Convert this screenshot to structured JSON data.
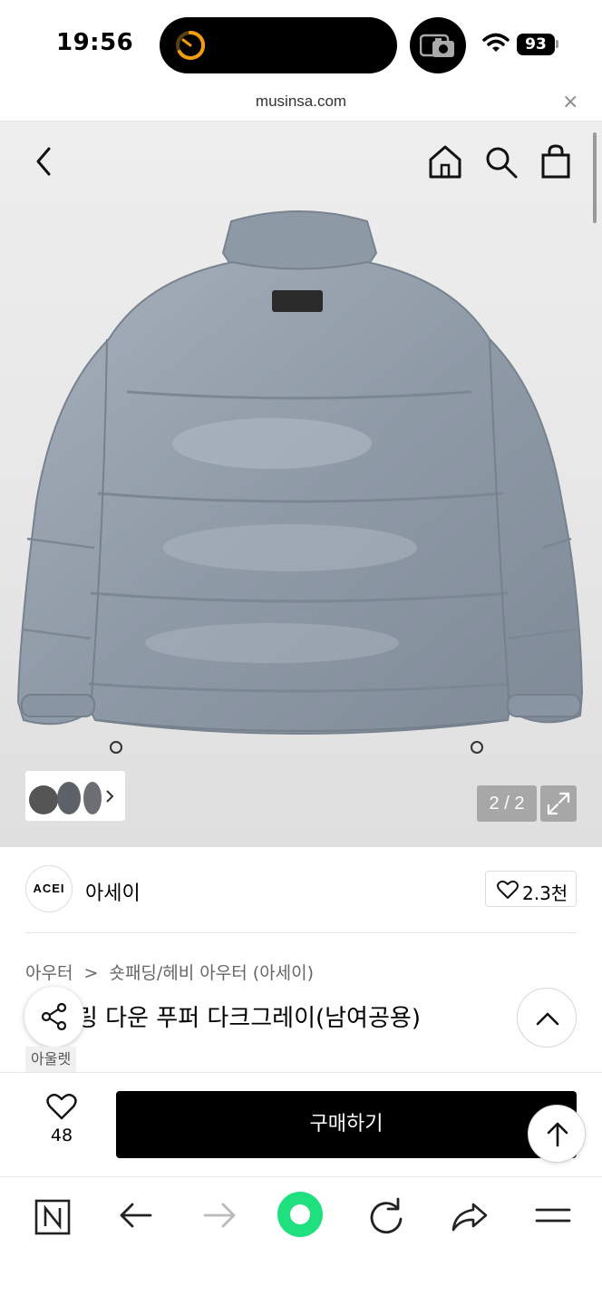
{
  "status_bar": {
    "time": "19:56",
    "battery": "93"
  },
  "url_bar": {
    "url": "musinsa.com",
    "close_glyph": "×"
  },
  "hero": {
    "image_counter": "2 / 2",
    "icons": [
      "back-chevron-icon",
      "home-icon",
      "search-icon",
      "shopping-bag-icon",
      "expand-icon",
      "chevron-right-icon"
    ]
  },
  "brand": {
    "logo_text": "ACEI",
    "name": "아세이",
    "likes": "2.3천"
  },
  "product": {
    "breadcrumb": [
      "아우터",
      "숏패딩/헤비 아우터 (아세이)"
    ],
    "breadcrumb_separator": ">",
    "title": "링 다운 푸퍼 다크그레이(남여공용)",
    "badge": "아울렛"
  },
  "purchase": {
    "wish_count": "48",
    "buy_label": "구매하기"
  },
  "colors": {
    "accent_green": "#1ee07f",
    "jacket": "#8e9aa8",
    "button_black": "#000000",
    "timer_orange": "#f39c12"
  }
}
